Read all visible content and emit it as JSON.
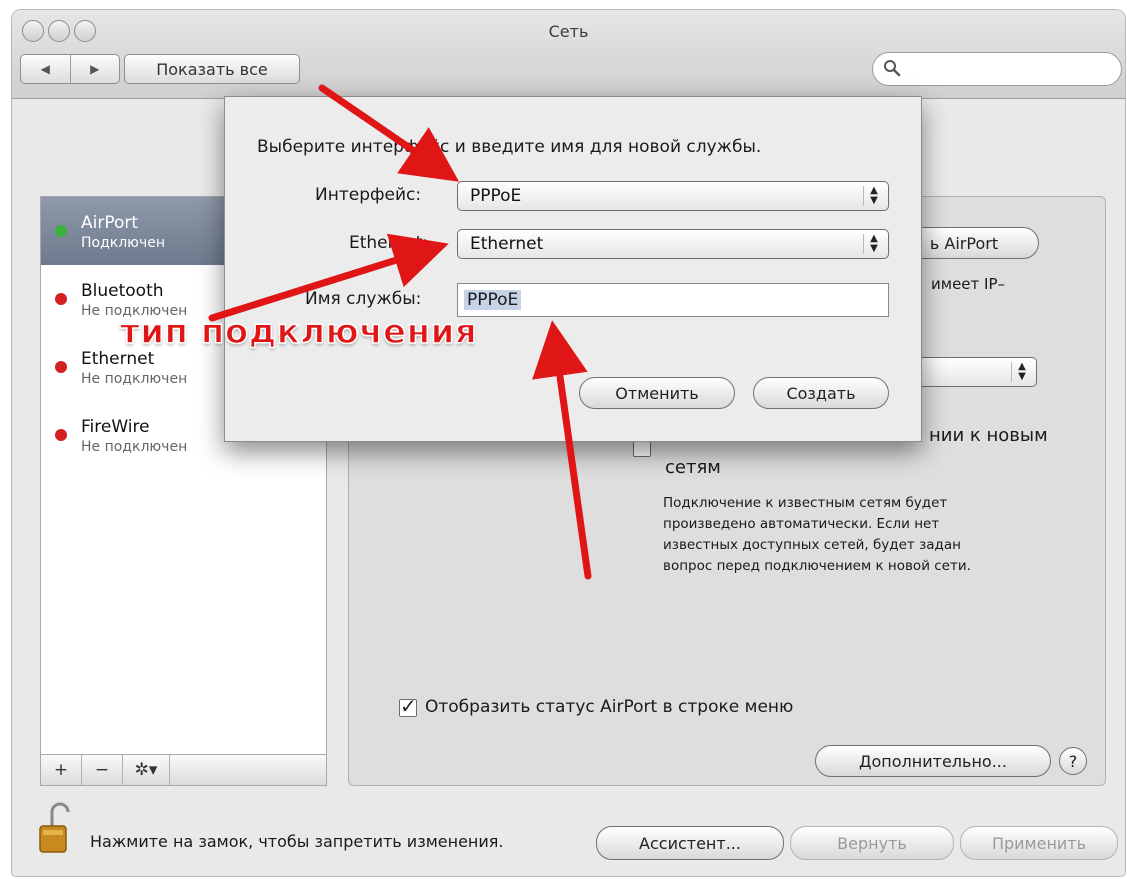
{
  "window": {
    "title": "Сеть",
    "show_all_label": "Показать все",
    "back_label": "◀",
    "forward_label": "▶",
    "search_placeholder": ""
  },
  "sidebar": {
    "items": [
      {
        "name": "AirPort",
        "status": "Подключен",
        "dot_color": "#3bb23b",
        "selected": true
      },
      {
        "name": "Bluetooth",
        "status": "Не подключен",
        "dot_color": "#d32020",
        "selected": false
      },
      {
        "name": "Ethernet",
        "status": "Не подключен",
        "dot_color": "#d32020",
        "selected": false
      },
      {
        "name": "FireWire",
        "status": "Не подключен",
        "dot_color": "#d32020",
        "selected": false
      }
    ],
    "add_label": "+",
    "remove_label": "−",
    "action_label": "✲▾"
  },
  "panel": {
    "airport_button": "ь AirPort",
    "ip_text": "имеет IP–",
    "join_new_text": "нии к новым",
    "join_new_text_2": "сетям",
    "description": [
      "Подключение к известным сетям будет",
      "произведено автоматически. Если нет",
      "известных доступных сетей, будет задан",
      "вопрос перед подключением к новой сети."
    ],
    "show_status_label": "Отобразить статус AirPort в строке меню",
    "show_status_check": "✓",
    "advanced_button": "Дополнительно...",
    "help_label": "?"
  },
  "sheet": {
    "prompt": "Выберите интерфейс и введите имя для новой службы.",
    "interface_label": "Интерфейс:",
    "interface_value": "PPPoE",
    "ethernet_label": "Ethernet:",
    "ethernet_value": "Ethernet",
    "service_name_label": "Имя службы:",
    "service_name_value": "PPPoE",
    "cancel_button": "Отменить",
    "create_button": "Создать"
  },
  "footer": {
    "lock_text": "Нажмите на замок, чтобы запретить изменения.",
    "assistant_button": "Ассистент...",
    "revert_button": "Вернуть",
    "apply_button": "Применить"
  },
  "annotation": {
    "text": "тип подключения",
    "color": "#e01616"
  }
}
